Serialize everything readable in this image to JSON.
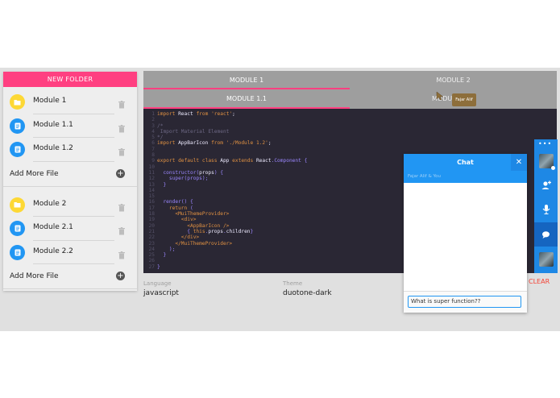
{
  "sidebar": {
    "new_folder_label": "NEW FOLDER",
    "groups": [
      {
        "files": [
          {
            "label": "Module 1",
            "icon": "folder-icon"
          },
          {
            "label": "Module 1.1",
            "icon": "document-icon"
          },
          {
            "label": "Module 1.2",
            "icon": "document-icon"
          }
        ],
        "add_label": "Add More File"
      },
      {
        "files": [
          {
            "label": "Module 2",
            "icon": "folder-icon"
          },
          {
            "label": "Module 2.1",
            "icon": "document-icon"
          },
          {
            "label": "Module 2.2",
            "icon": "document-icon"
          }
        ],
        "add_label": "Add More File"
      }
    ]
  },
  "tabs": [
    "MODULE 1",
    "MODULE 2"
  ],
  "subtabs": [
    "MODULE 1.1",
    "MODU"
  ],
  "tooltip": "Fajar Alif",
  "editor": {
    "lines": [
      {
        "n": "1",
        "parts": [
          [
            "kw",
            "import "
          ],
          [
            "plain",
            "React "
          ],
          [
            "kw",
            "from "
          ],
          [
            "str",
            "'react'"
          ],
          [
            "plain",
            ";"
          ]
        ]
      },
      {
        "n": "2",
        "parts": []
      },
      {
        "n": "3",
        "parts": [
          [
            "cm",
            "/*"
          ]
        ]
      },
      {
        "n": "4",
        "parts": [
          [
            "cm",
            " Import Material Element"
          ]
        ]
      },
      {
        "n": "5",
        "parts": [
          [
            "cm",
            "*/"
          ]
        ]
      },
      {
        "n": "6",
        "parts": [
          [
            "kw",
            "import "
          ],
          [
            "plain",
            "AppBarIcon "
          ],
          [
            "kw",
            "from "
          ],
          [
            "str",
            "'./Module 1.2'"
          ],
          [
            "plain",
            ";"
          ]
        ]
      },
      {
        "n": "7",
        "parts": []
      },
      {
        "n": "8",
        "parts": []
      },
      {
        "n": "9",
        "parts": [
          [
            "kw",
            "export default class "
          ],
          [
            "plain",
            "App "
          ],
          [
            "kw",
            "extends "
          ],
          [
            "plain",
            "React"
          ],
          [
            "punc",
            "."
          ],
          [
            "fn",
            "Component"
          ],
          [
            "punc",
            " {"
          ]
        ]
      },
      {
        "n": "10",
        "parts": []
      },
      {
        "n": "11",
        "parts": [
          [
            "plain",
            "  "
          ],
          [
            "fn",
            "constructor"
          ],
          [
            "punc",
            "("
          ],
          [
            "plain",
            "props"
          ],
          [
            "punc",
            ") {"
          ]
        ]
      },
      {
        "n": "12",
        "parts": [
          [
            "plain",
            "    "
          ],
          [
            "fn",
            "super"
          ],
          [
            "punc",
            "(props);"
          ]
        ]
      },
      {
        "n": "13",
        "parts": [
          [
            "punc",
            "  }"
          ]
        ]
      },
      {
        "n": "14",
        "parts": []
      },
      {
        "n": "15",
        "parts": []
      },
      {
        "n": "16",
        "parts": [
          [
            "plain",
            "  "
          ],
          [
            "fn",
            "render"
          ],
          [
            "punc",
            "() {"
          ]
        ]
      },
      {
        "n": "17",
        "parts": [
          [
            "kw",
            "    return "
          ],
          [
            "punc",
            "("
          ]
        ]
      },
      {
        "n": "18",
        "parts": [
          [
            "tag",
            "      <MuiThemeProvider>"
          ]
        ]
      },
      {
        "n": "19",
        "parts": [
          [
            "tag",
            "        <div>"
          ]
        ]
      },
      {
        "n": "20",
        "parts": [
          [
            "tag",
            "          <AppBarIcon />"
          ]
        ]
      },
      {
        "n": "21",
        "parts": [
          [
            "punc",
            "          { "
          ],
          [
            "kw",
            "this"
          ],
          [
            "punc",
            "."
          ],
          [
            "plain",
            "props"
          ],
          [
            "punc",
            "."
          ],
          [
            "plain",
            "children"
          ],
          [
            "punc",
            "}"
          ]
        ]
      },
      {
        "n": "22",
        "parts": [
          [
            "tag",
            "        </div>"
          ]
        ]
      },
      {
        "n": "23",
        "parts": [
          [
            "tag",
            "      </MuiThemeProvider>"
          ]
        ]
      },
      {
        "n": "24",
        "parts": [
          [
            "punc",
            "    );"
          ]
        ]
      },
      {
        "n": "25",
        "parts": [
          [
            "punc",
            "  }"
          ]
        ]
      },
      {
        "n": "26",
        "parts": []
      },
      {
        "n": "27",
        "parts": [
          [
            "punc",
            "}"
          ]
        ]
      }
    ],
    "colors": {
      "kw": "#e09142",
      "str": "#e09142",
      "cm": "#6c6783",
      "plain": "#eeebff",
      "fn": "#9a86fd",
      "tag": "#e09142",
      "punc": "#9a86fd"
    }
  },
  "settings": {
    "language_label": "Language",
    "language_value": "javascript",
    "theme_label": "Theme",
    "theme_value": "duotone-dark",
    "clear_label": "CLEAR"
  },
  "chat": {
    "title": "Chat",
    "close_icon": "✕",
    "subtitle": "Fajar Alif & You",
    "input_value": "What is super function??"
  },
  "rail": {
    "dots": "•••",
    "buttons": [
      "avatar",
      "add-user-icon",
      "microphone-icon",
      "chat-bubble-icon",
      "avatar"
    ]
  }
}
